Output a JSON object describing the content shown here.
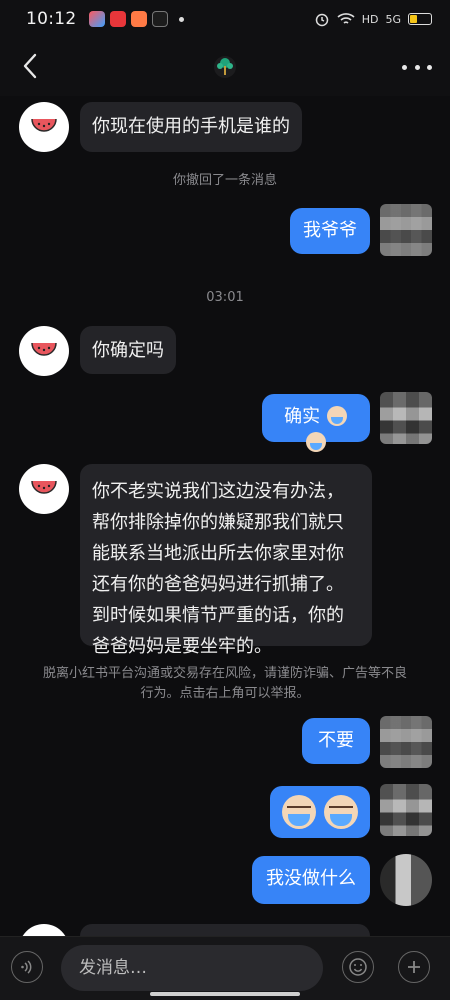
{
  "status_bar": {
    "time": "10:12",
    "network": "HD",
    "signal": "5G",
    "battery_level": 0.3
  },
  "header": {
    "back_icon": "chevron-left-icon",
    "contact_avatar": "peacock-avatar",
    "more_icon": "more-dots-icon"
  },
  "messages": [
    {
      "side": "left",
      "text": "你现在使用的手机是谁的"
    },
    {
      "type": "system",
      "text": "你撤回了一条消息"
    },
    {
      "side": "right",
      "text": "我爷爷"
    },
    {
      "type": "timestamp",
      "text": "03:01"
    },
    {
      "side": "left",
      "text": "你确定吗"
    },
    {
      "side": "right",
      "text": "确实"
    },
    {
      "side": "left",
      "text": "你不老实说我们这边没有办法，帮你排除掉你的嫌疑那我们就只能联系当地派出所去你家里对你还有你的爸爸妈妈进行抓捕了。到时候如果情节严重的话，你的爸爸妈妈是要坐牢的。"
    },
    {
      "type": "warning",
      "text": "脱离小红书平台沟通或交易存在风险，请谨防诈骗、广告等不良行为。点击右上角可以举报。"
    },
    {
      "side": "right",
      "text": "不要"
    },
    {
      "side": "right",
      "type": "sticker",
      "text": ""
    },
    {
      "side": "right",
      "text": "我没做什么"
    }
  ],
  "input": {
    "placeholder": "发消息…",
    "voice_icon": "voice-icon",
    "emoji_icon": "emoji-icon",
    "plus_icon": "plus-icon"
  },
  "colors": {
    "background": "#0d0d0f",
    "bubble_left": "#242428",
    "bubble_right": "#3784f7",
    "system_text": "#8a8a8e"
  }
}
